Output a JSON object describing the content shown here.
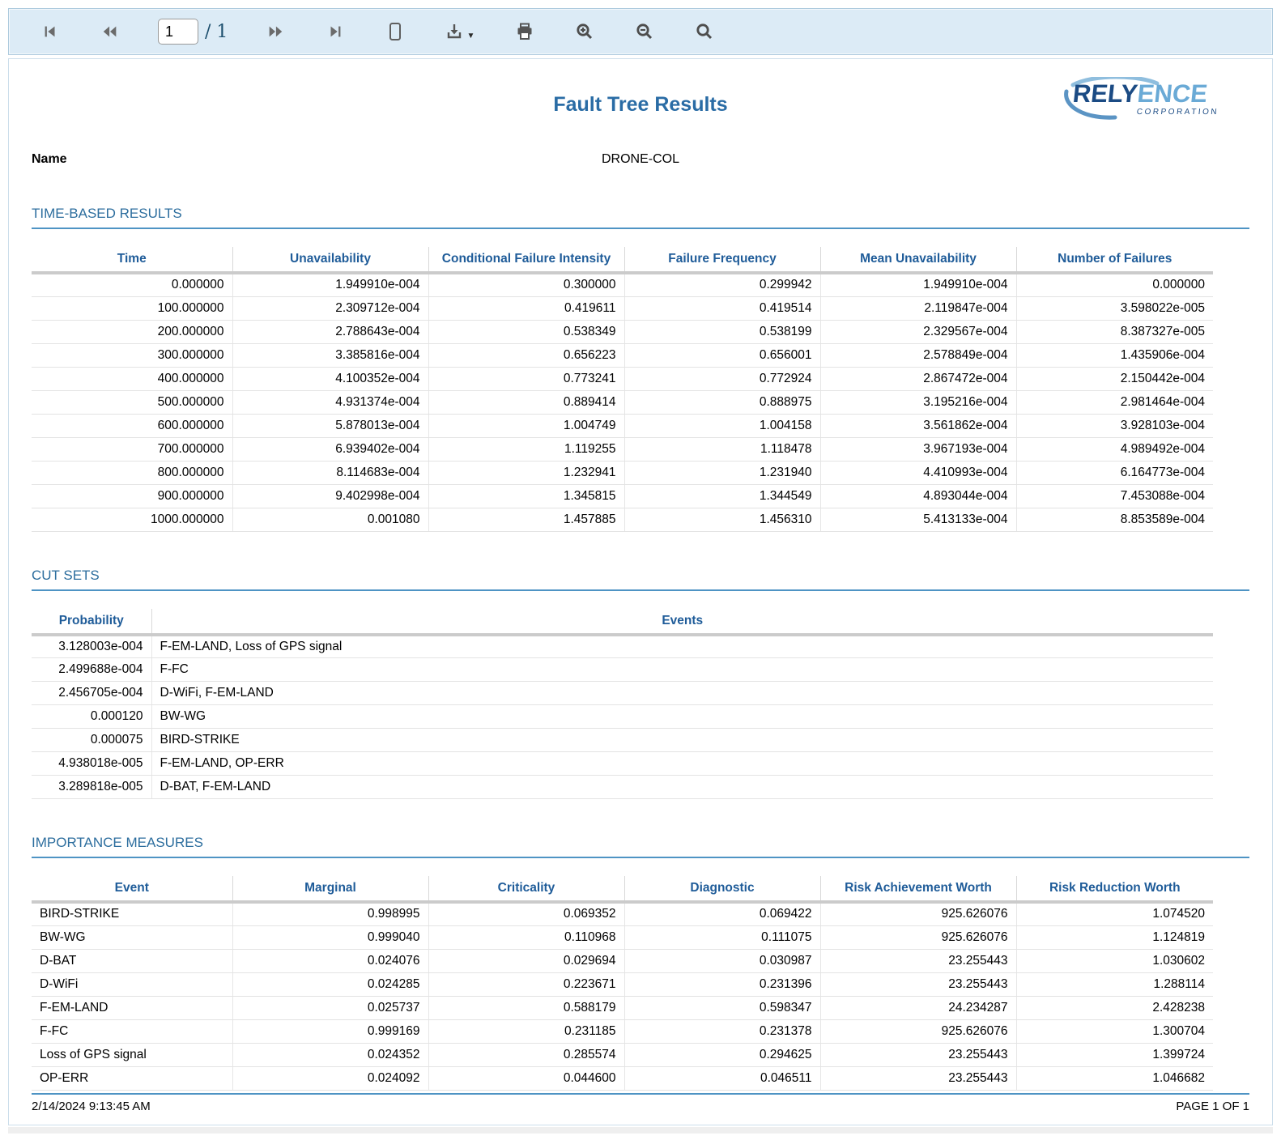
{
  "toolbar": {
    "page_input": "1",
    "page_total_label": "/ 1",
    "icons": [
      "first-page-icon",
      "previous-page-icon",
      "next-page-icon",
      "last-page-icon",
      "single-page-view-icon",
      "download-icon",
      "print-icon",
      "zoom-in-icon",
      "zoom-out-icon",
      "search-icon"
    ]
  },
  "report": {
    "title": "Fault Tree Results",
    "logo": {
      "word_part1": "RELY",
      "word_part2": "ENCE",
      "subtitle": "CORPORATION"
    },
    "name_label": "Name",
    "name_value": "DRONE-COL"
  },
  "time_based": {
    "heading": "TIME-BASED RESULTS",
    "columns": [
      "Time",
      "Unavailability",
      "Conditional Failure Intensity",
      "Failure Frequency",
      "Mean Unavailability",
      "Number of Failures"
    ],
    "rows": [
      [
        "0.000000",
        "1.949910e-004",
        "0.300000",
        "0.299942",
        "1.949910e-004",
        "0.000000"
      ],
      [
        "100.000000",
        "2.309712e-004",
        "0.419611",
        "0.419514",
        "2.119847e-004",
        "3.598022e-005"
      ],
      [
        "200.000000",
        "2.788643e-004",
        "0.538349",
        "0.538199",
        "2.329567e-004",
        "8.387327e-005"
      ],
      [
        "300.000000",
        "3.385816e-004",
        "0.656223",
        "0.656001",
        "2.578849e-004",
        "1.435906e-004"
      ],
      [
        "400.000000",
        "4.100352e-004",
        "0.773241",
        "0.772924",
        "2.867472e-004",
        "2.150442e-004"
      ],
      [
        "500.000000",
        "4.931374e-004",
        "0.889414",
        "0.888975",
        "3.195216e-004",
        "2.981464e-004"
      ],
      [
        "600.000000",
        "5.878013e-004",
        "1.004749",
        "1.004158",
        "3.561862e-004",
        "3.928103e-004"
      ],
      [
        "700.000000",
        "6.939402e-004",
        "1.119255",
        "1.118478",
        "3.967193e-004",
        "4.989492e-004"
      ],
      [
        "800.000000",
        "8.114683e-004",
        "1.232941",
        "1.231940",
        "4.410993e-004",
        "6.164773e-004"
      ],
      [
        "900.000000",
        "9.402998e-004",
        "1.345815",
        "1.344549",
        "4.893044e-004",
        "7.453088e-004"
      ],
      [
        "1000.000000",
        "0.001080",
        "1.457885",
        "1.456310",
        "5.413133e-004",
        "8.853589e-004"
      ]
    ]
  },
  "cut_sets": {
    "heading": "CUT SETS",
    "columns": [
      "Probability",
      "Events"
    ],
    "rows": [
      [
        "3.128003e-004",
        "F-EM-LAND, Loss of GPS signal"
      ],
      [
        "2.499688e-004",
        "F-FC"
      ],
      [
        "2.456705e-004",
        "D-WiFi, F-EM-LAND"
      ],
      [
        "0.000120",
        "BW-WG"
      ],
      [
        "0.000075",
        "BIRD-STRIKE"
      ],
      [
        "4.938018e-005",
        "F-EM-LAND, OP-ERR"
      ],
      [
        "3.289818e-005",
        "D-BAT, F-EM-LAND"
      ]
    ]
  },
  "importance": {
    "heading": "IMPORTANCE MEASURES",
    "columns": [
      "Event",
      "Marginal",
      "Criticality",
      "Diagnostic",
      "Risk Achievement Worth",
      "Risk Reduction Worth"
    ],
    "rows": [
      [
        "BIRD-STRIKE",
        "0.998995",
        "0.069352",
        "0.069422",
        "925.626076",
        "1.074520"
      ],
      [
        "BW-WG",
        "0.999040",
        "0.110968",
        "0.111075",
        "925.626076",
        "1.124819"
      ],
      [
        "D-BAT",
        "0.024076",
        "0.029694",
        "0.030987",
        "23.255443",
        "1.030602"
      ],
      [
        "D-WiFi",
        "0.024285",
        "0.223671",
        "0.231396",
        "23.255443",
        "1.288114"
      ],
      [
        "F-EM-LAND",
        "0.025737",
        "0.588179",
        "0.598347",
        "24.234287",
        "2.428238"
      ],
      [
        "F-FC",
        "0.999169",
        "0.231185",
        "0.231378",
        "925.626076",
        "1.300704"
      ],
      [
        "Loss of GPS signal",
        "0.024352",
        "0.285574",
        "0.294625",
        "23.255443",
        "1.399724"
      ],
      [
        "OP-ERR",
        "0.024092",
        "0.044600",
        "0.046511",
        "23.255443",
        "1.046682"
      ]
    ]
  },
  "footer": {
    "timestamp": "2/14/2024 9:13:45 AM",
    "page_label": "PAGE 1 OF 1"
  },
  "colors": {
    "accent_blue": "#2d6e9e",
    "header_text_blue": "#1f5c99",
    "rule_blue": "#4e94c4",
    "toolbar_bg": "#dcebf6",
    "logo_dark_blue": "#1b4b84",
    "logo_light_blue": "#6aaad6"
  }
}
